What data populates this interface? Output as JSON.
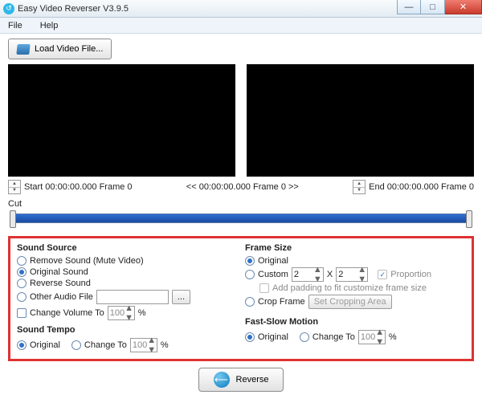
{
  "window": {
    "title": "Easy Video Reverser V3.9.5"
  },
  "menu": {
    "file": "File",
    "help": "Help"
  },
  "toolbar": {
    "load": "Load Video File..."
  },
  "time": {
    "start": "Start 00:00:00.000 Frame 0",
    "mid": "<< 00:00:00.000  Frame 0 >>",
    "end": "End 00:00:00.000  Frame 0"
  },
  "cut": {
    "label": "Cut"
  },
  "sound_source": {
    "title": "Sound Source",
    "remove": "Remove Sound (Mute Video)",
    "original": "Original Sound",
    "reverse": "Reverse Sound",
    "other": "Other Audio File",
    "browse": "...",
    "change_volume": "Change Volume To",
    "volume_value": "100",
    "percent": "%"
  },
  "sound_tempo": {
    "title": "Sound Tempo",
    "original": "Original",
    "change_to": "Change To",
    "value": "100",
    "percent": "%"
  },
  "frame_size": {
    "title": "Frame Size",
    "original": "Original",
    "custom": "Custom",
    "w": "2",
    "x": "X",
    "h": "2",
    "proportion": "Proportion",
    "padding": "Add padding to fit customize frame size",
    "crop": "Crop Frame",
    "set_crop": "Set Cropping Area"
  },
  "motion": {
    "title": "Fast-Slow Motion",
    "original": "Original",
    "change_to": "Change To",
    "value": "100",
    "percent": "%"
  },
  "action": {
    "reverse": "Reverse"
  }
}
